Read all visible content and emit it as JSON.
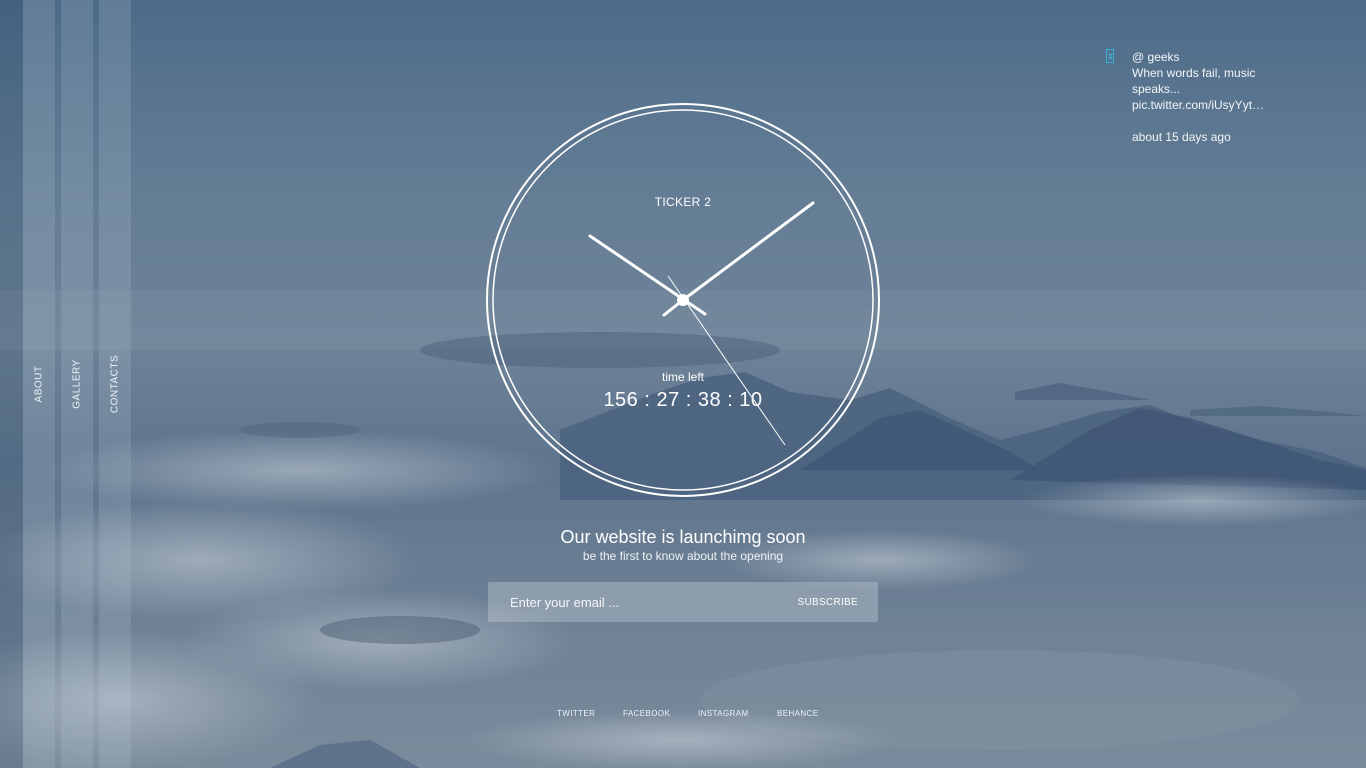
{
  "nav": {
    "about": "ABOUT",
    "gallery": "GALLERY",
    "contacts": "CONTACTS"
  },
  "tweet": {
    "icon": "twitter-icon",
    "handle": "@ geeks",
    "text": "When words fail, music speaks...",
    "link": "pic.twitter.com/iUsyYyt…",
    "time": "about 15 days ago"
  },
  "clock": {
    "title": "TICKER 2",
    "subtitle": "time left",
    "countdown": "156 : 27 : 38 : 10"
  },
  "hero": {
    "headline": "Our website is launchimg soon",
    "subline": "be the first to know about the opening"
  },
  "subscribe": {
    "placeholder": "Enter your email ...",
    "button_label": "SUBSCRIBE"
  },
  "social": {
    "twitter": "TWITTER",
    "facebook": "FACEBOOK",
    "instagram": "INSTAGRAM",
    "behance": "BEHANCE"
  },
  "colors": {
    "accent": "#3fb4d8",
    "text": "#ffffff"
  }
}
